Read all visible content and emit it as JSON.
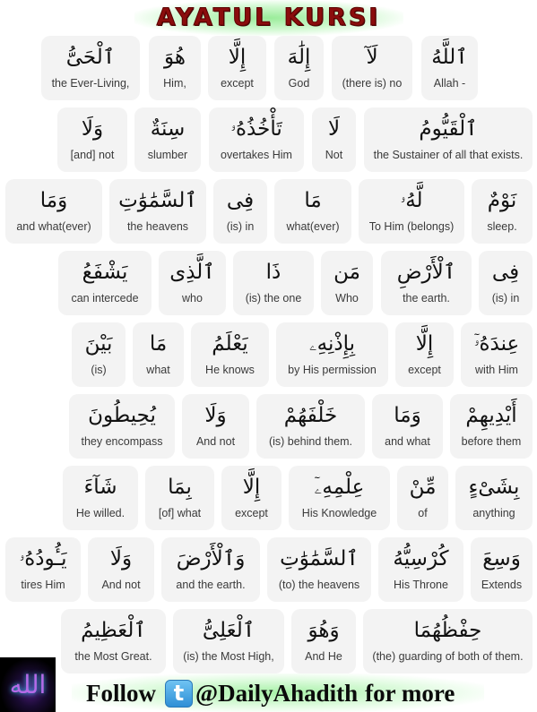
{
  "title": "AYATUL KURSI",
  "footer": {
    "follow_label": "Follow",
    "twitter_icon": "twitter-bird-icon",
    "handle": "@DailyAhadith",
    "suffix": "for more"
  },
  "logo": {
    "icon": "allah-calligraphy-logo",
    "glyph": "الله"
  },
  "colors": {
    "title": "#8b0d0d",
    "glow": "#7fe67f",
    "card_bg": "#f3f3f3",
    "twitter_blue": "#3a9ee0"
  },
  "rows": [
    {
      "words": [
        {
          "ar": "ٱللَّهُ",
          "en": "Allah -"
        },
        {
          "ar": "لَآ",
          "en": "(there is) no"
        },
        {
          "ar": "إِلَٰهَ",
          "en": "God"
        },
        {
          "ar": "إِلَّا",
          "en": "except"
        },
        {
          "ar": "هُوَ",
          "en": "Him,"
        },
        {
          "ar": "ٱلْحَىُّ",
          "en": "the Ever-Living,"
        }
      ]
    },
    {
      "words": [
        {
          "ar": "ٱلْقَيُّومُ",
          "en": "the Sustainer of all that exists."
        },
        {
          "ar": "لَا",
          "en": "Not"
        },
        {
          "ar": "تَأْخُذُهُۥ",
          "en": "overtakes Him"
        },
        {
          "ar": "سِنَةٌ",
          "en": "slumber"
        },
        {
          "ar": "وَلَا",
          "en": "[and] not"
        }
      ]
    },
    {
      "words": [
        {
          "ar": "نَوْمٌ",
          "en": "sleep."
        },
        {
          "ar": "لَّهُۥ",
          "en": "To Him (belongs)"
        },
        {
          "ar": "مَا",
          "en": "what(ever)"
        },
        {
          "ar": "فِى",
          "en": "(is) in"
        },
        {
          "ar": "ٱلسَّمَٰوَٰتِ",
          "en": "the heavens"
        },
        {
          "ar": "وَمَا",
          "en": "and what(ever)"
        }
      ]
    },
    {
      "words": [
        {
          "ar": "فِى",
          "en": "(is) in"
        },
        {
          "ar": "ٱلْأَرْضِ",
          "en": "the earth."
        },
        {
          "ar": "مَن",
          "en": "Who"
        },
        {
          "ar": "ذَا",
          "en": "(is) the one"
        },
        {
          "ar": "ٱلَّذِى",
          "en": "who"
        },
        {
          "ar": "يَشْفَعُ",
          "en": "can intercede"
        }
      ]
    },
    {
      "words": [
        {
          "ar": "عِندَهُۥٓ",
          "en": "with Him"
        },
        {
          "ar": "إِلَّا",
          "en": "except"
        },
        {
          "ar": "بِإِذْنِهِۦ",
          "en": "by His permission"
        },
        {
          "ar": "يَعْلَمُ",
          "en": "He knows"
        },
        {
          "ar": "مَا",
          "en": "what"
        },
        {
          "ar": "بَيْنَ",
          "en": "(is)"
        }
      ]
    },
    {
      "words": [
        {
          "ar": "أَيْدِيهِمْ",
          "en": "before them"
        },
        {
          "ar": "وَمَا",
          "en": "and what"
        },
        {
          "ar": "خَلْفَهُمْ",
          "en": "(is) behind them."
        },
        {
          "ar": "وَلَا",
          "en": "And not"
        },
        {
          "ar": "يُحِيطُونَ",
          "en": "they encompass"
        }
      ]
    },
    {
      "words": [
        {
          "ar": "بِشَىْءٍ",
          "en": "anything"
        },
        {
          "ar": "مِّنْ",
          "en": "of"
        },
        {
          "ar": "عِلْمِهِۦٓ",
          "en": "His Knowledge"
        },
        {
          "ar": "إِلَّا",
          "en": "except"
        },
        {
          "ar": "بِمَا",
          "en": "[of] what"
        },
        {
          "ar": "شَآءَ",
          "en": "He willed."
        }
      ]
    },
    {
      "words": [
        {
          "ar": "وَسِعَ",
          "en": "Extends"
        },
        {
          "ar": "كُرْسِيُّهُ",
          "en": "His Throne"
        },
        {
          "ar": "ٱلسَّمَٰوَٰتِ",
          "en": "(to) the heavens"
        },
        {
          "ar": "وَٱلْأَرْضَ",
          "en": "and the earth."
        },
        {
          "ar": "وَلَا",
          "en": "And not"
        },
        {
          "ar": "يَـُٔودُهُۥ",
          "en": "tires Him"
        }
      ]
    },
    {
      "words": [
        {
          "ar": "حِفْظُهُمَا",
          "en": "(the) guarding of both of them."
        },
        {
          "ar": "وَهُوَ",
          "en": "And He"
        },
        {
          "ar": "ٱلْعَلِىُّ",
          "en": "(is) the Most High,"
        },
        {
          "ar": "ٱلْعَظِيمُ",
          "en": "the Most Great."
        }
      ]
    }
  ]
}
